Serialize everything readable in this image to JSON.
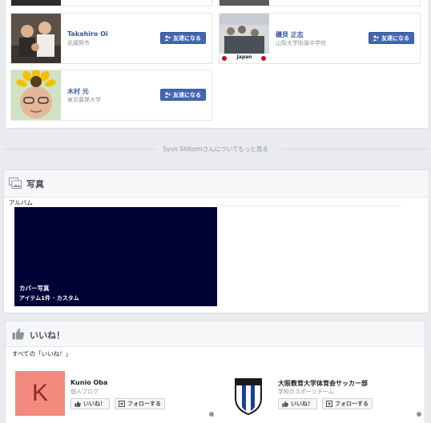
{
  "friends_section": {
    "friends": [
      {
        "name": "Takahiro Oi",
        "subtitle": "武蔵野市",
        "button": "友達になる",
        "photo": "people-photo"
      },
      {
        "name": "磯貝 正志",
        "subtitle": "山梨大学附属中学校",
        "button": "友達になる",
        "photo": "team-photo",
        "photo_caption": "Japan"
      },
      {
        "name": "木村 元",
        "subtitle": "東京農業大学",
        "button": "友達になる",
        "photo": "sunflower-face-photo"
      }
    ]
  },
  "see_more": {
    "label": "Syun Shitomiさんについてもっと見る"
  },
  "photos_section": {
    "title": "写真",
    "albums_label": "アルバム",
    "cover_album": {
      "title": "カバー写真",
      "subtitle": "アイテム1件 · カスタム",
      "color": "#000236"
    }
  },
  "likes_section": {
    "title": "いいね！",
    "all_label": "すべての「いいね！」",
    "pages": [
      {
        "name": "Kunio Oba",
        "category": "個人ブログ",
        "like_button": "いいね！",
        "follow_button": "フォローする",
        "avatar_letter": "K",
        "avatar_color": "#f28b7d"
      },
      {
        "name": "大阪教育大学体育会サッカー部",
        "category": "学校のスポーツチーム",
        "like_button": "いいね！",
        "follow_button": "フォローする"
      }
    ]
  }
}
